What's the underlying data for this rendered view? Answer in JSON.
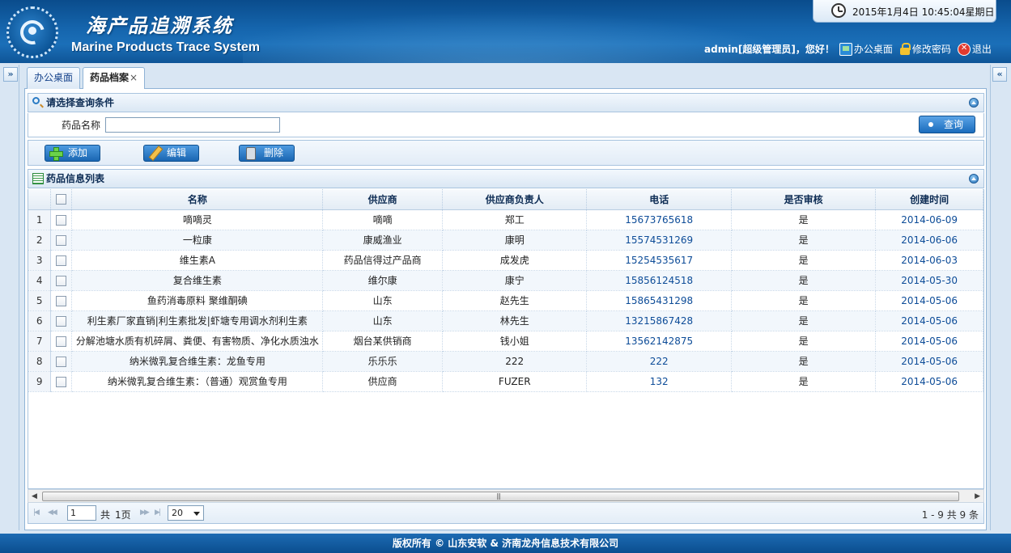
{
  "header": {
    "title_cn": "海产品追溯系统",
    "title_en": "Marine Products Trace System",
    "datetime": "2015年1月4日  10:45:04星期日",
    "greeting": "admin[超级管理员]，您好！",
    "links": {
      "desktop": "办公桌面",
      "change_password": "修改密码",
      "logout": "退出"
    },
    "colors": {
      "header_blue": "#1565ad",
      "footer_blue": "#0b4e8f"
    }
  },
  "tabs": [
    {
      "label": "办公桌面",
      "active": false
    },
    {
      "label": "药品档案",
      "active": true,
      "close": "×"
    }
  ],
  "query": {
    "title": "请选择查询条件",
    "field_label": "药品名称",
    "field_value": "",
    "button_label": "查询"
  },
  "toolbar": {
    "add_label": "添加",
    "edit_label": "编辑",
    "delete_label": "删除"
  },
  "list": {
    "title": "药品信息列表",
    "columns": [
      "名称",
      "供应商",
      "供应商负责人",
      "电话",
      "是否审核",
      "创建时间"
    ],
    "rows": [
      {
        "n": "1",
        "name": "嘀嘀灵",
        "supplier": "嘀嘀",
        "contact": "郑工",
        "phone": "15673765618",
        "audited": "是",
        "created": "2014-06-09"
      },
      {
        "n": "2",
        "name": "一粒康",
        "supplier": "康威渔业",
        "contact": "康明",
        "phone": "15574531269",
        "audited": "是",
        "created": "2014-06-06"
      },
      {
        "n": "3",
        "name": "维生素A",
        "supplier": "药品信得过产品商",
        "contact": "成发虎",
        "phone": "15254535617",
        "audited": "是",
        "created": "2014-06-03"
      },
      {
        "n": "4",
        "name": "复合维生素",
        "supplier": "维尔康",
        "contact": "康宁",
        "phone": "15856124518",
        "audited": "是",
        "created": "2014-05-30"
      },
      {
        "n": "5",
        "name": "鱼药消毒原料 聚维酮碘",
        "supplier": "山东",
        "contact": "赵先生",
        "phone": "15865431298",
        "audited": "是",
        "created": "2014-05-06"
      },
      {
        "n": "6",
        "name": "利生素厂家直销|利生素批发|虾塘专用调水剂利生素",
        "supplier": "山东",
        "contact": "林先生",
        "phone": "13215867428",
        "audited": "是",
        "created": "2014-05-06"
      },
      {
        "n": "7",
        "name": "分解池塘水质有机碎屑、粪便、有害物质、净化水质浊水",
        "supplier": "烟台某供销商",
        "contact": "钱小姐",
        "phone": "13562142875",
        "audited": "是",
        "created": "2014-05-06"
      },
      {
        "n": "8",
        "name": "纳米微乳复合维生素：龙鱼专用",
        "supplier": "乐乐乐",
        "contact": "222",
        "phone": "222",
        "audited": "是",
        "created": "2014-05-06"
      },
      {
        "n": "9",
        "name": "纳米微乳复合维生素：（普通）观赏鱼专用",
        "supplier": "供应商",
        "contact": "FUZER",
        "phone": "132",
        "audited": "是",
        "created": "2014-05-06"
      }
    ]
  },
  "pager": {
    "page_value": "1",
    "page_total_prefix": "共",
    "page_total": "1页",
    "page_size": "20",
    "info": "1 - 9    共  9 条"
  },
  "footer": {
    "copyright": "版权所有 © 山东安软 & 济南龙舟信息技术有限公司"
  }
}
